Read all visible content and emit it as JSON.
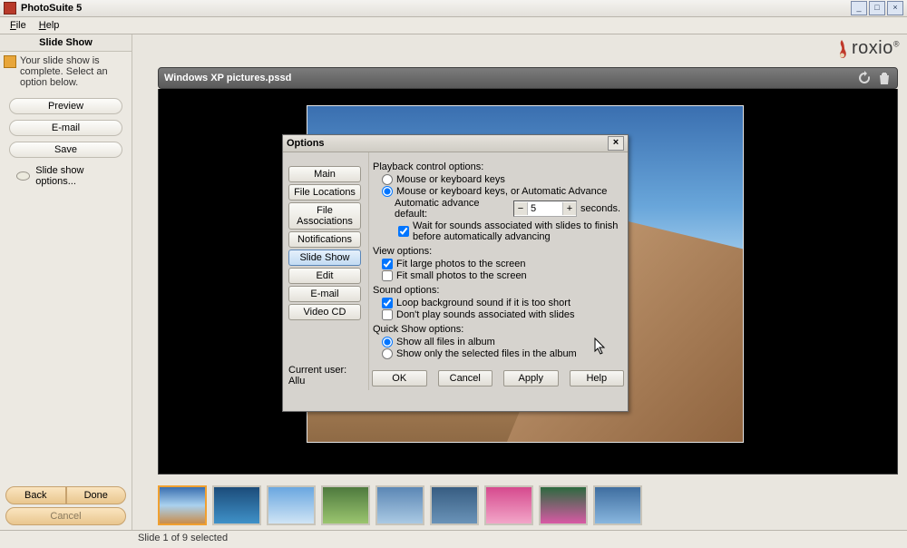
{
  "window": {
    "title": "PhotoSuite 5"
  },
  "menu": {
    "file": "File",
    "help": "Help"
  },
  "sidebar": {
    "header": "Slide Show",
    "note": "Your slide show is complete. Select an option below.",
    "buttons": {
      "preview": "Preview",
      "email": "E-mail",
      "save": "Save"
    },
    "options_label": "Slide show options...",
    "nav": {
      "back": "Back",
      "done": "Done",
      "cancel": "Cancel"
    }
  },
  "brand": {
    "name": "roxio"
  },
  "document": {
    "title": "Windows XP pictures.pssd"
  },
  "status": {
    "text": "Slide 1 of 9 selected"
  },
  "dialog": {
    "title": "Options",
    "tabs": [
      "Main",
      "File Locations",
      "File Associations",
      "Notifications",
      "Slide Show",
      "Edit",
      "E-mail",
      "Video CD"
    ],
    "active_tab": 4,
    "current_user_label": "Current user:",
    "current_user_value": "Allu",
    "buttons": {
      "ok": "OK",
      "cancel": "Cancel",
      "apply": "Apply",
      "help": "Help"
    },
    "playback": {
      "header": "Playback control options:",
      "opt1": "Mouse or keyboard keys",
      "opt2": "Mouse or keyboard keys, or Automatic Advance",
      "auto_label_pre": "Automatic advance default:",
      "auto_value": "5",
      "auto_label_post": "seconds.",
      "wait_sounds": "Wait for sounds associated with slides to finish before automatically advancing"
    },
    "view": {
      "header": "View options:",
      "fit_large": "Fit large photos to the screen",
      "fit_small": "Fit small photos to the screen"
    },
    "sound": {
      "header": "Sound options:",
      "loop_bg": "Loop background sound if it is too short",
      "dont_play": "Don't play sounds associated with slides"
    },
    "quickshow": {
      "header": "Quick Show options:",
      "show_all": "Show all files in album",
      "show_selected": "Show only the selected files in the album"
    }
  }
}
